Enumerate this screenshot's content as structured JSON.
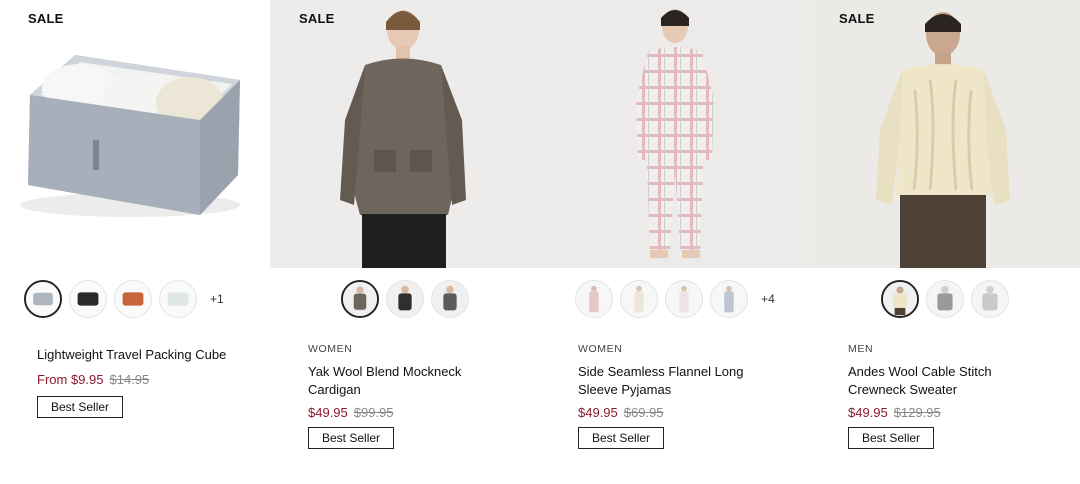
{
  "products": [
    {
      "tag": "SALE",
      "category": "",
      "name": "Lightweight Travel Packing Cube",
      "price": "From $9.95",
      "original_price": "$14.95",
      "badge": "Best Seller",
      "more_colors": "+1",
      "swatch_colors": [
        "#aeb5bd",
        "#2b2b2b",
        "#c8643a",
        "#dfe8e4"
      ]
    },
    {
      "tag": "SALE",
      "category": "WOMEN",
      "name": "Yak Wool Blend Mockneck Cardigan",
      "price": "$49.95",
      "original_price": "$99.95",
      "badge": "Best Seller",
      "more_colors": "",
      "swatch_colors": [
        "#6e655c",
        "#2f2f2f",
        "#5a5a5a"
      ]
    },
    {
      "tag": "",
      "category": "WOMEN",
      "name": "Side Seamless Flannel Long Sleeve Pyjamas",
      "price": "$49.95",
      "original_price": "$69.95",
      "badge": "Best Seller",
      "more_colors": "+4",
      "swatch_colors": [
        "#e7c6c8",
        "#ece5da",
        "#f1e3e3",
        "#bfc6d1"
      ]
    },
    {
      "tag": "SALE",
      "category": "MEN",
      "name": "Andes Wool Cable Stitch Crewneck Sweater",
      "price": "$49.95",
      "original_price": "$129.95",
      "badge": "Best Seller",
      "more_colors": "",
      "swatch_colors": [
        "#efe5c8",
        "#9a9a9a",
        "#c9c9c9"
      ]
    }
  ],
  "colors": {
    "sale_price": "#8b1a2b",
    "strike_price": "#888888"
  }
}
